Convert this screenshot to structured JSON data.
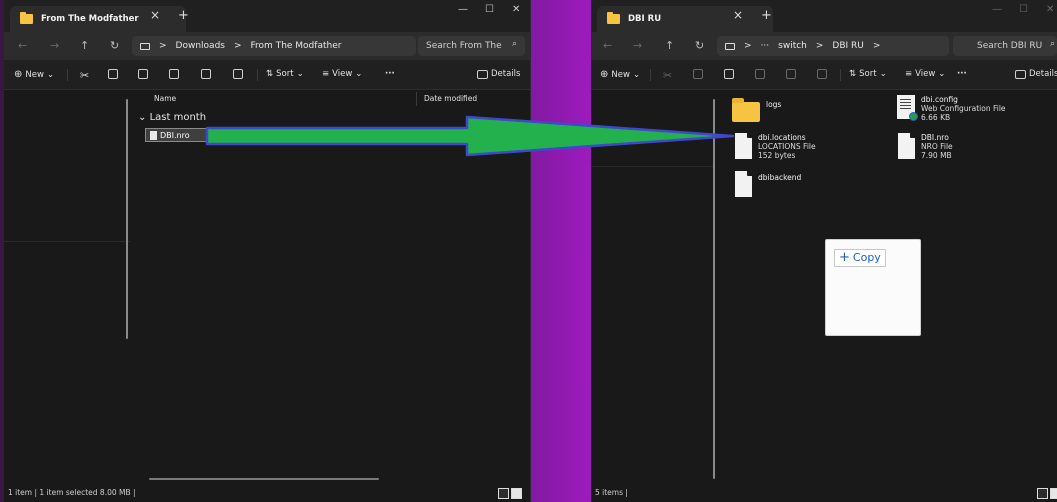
{
  "left_window": {
    "tab_title": "From The Modfather",
    "tab_close": "×",
    "tab_new": "+",
    "controls": {
      "minimize": "—",
      "maximize": "☐",
      "close": "✕"
    },
    "nav": {
      "back": "←",
      "forward": "→",
      "up": "↑",
      "refresh": "↻"
    },
    "breadcrumb": {
      "sep1": ">",
      "item1": "Downloads",
      "sep2": ">",
      "item2": "From The Modfather"
    },
    "search_placeholder": "Search From The",
    "search_icon": "⌕",
    "commands": {
      "new_label": "New",
      "sort_label": "Sort",
      "view_label": "View",
      "more_label": "···",
      "details_label": "Details",
      "chevron": "⌄"
    },
    "columns": {
      "name": "Name",
      "date_modified": "Date modified"
    },
    "group": {
      "chevron": "⌄",
      "label": "Last month"
    },
    "files": [
      {
        "name": "DBI.nro"
      }
    ],
    "status": "1 item  |  1 item selected  8.00 MB  |"
  },
  "right_window": {
    "tab_title": "DBI RU",
    "tab_close": "×",
    "tab_new": "+",
    "controls": {
      "minimize": "—",
      "maximize": "☐",
      "close": "✕"
    },
    "nav": {
      "back": "←",
      "forward": "→",
      "up": "↑",
      "refresh": "↻"
    },
    "breadcrumb": {
      "sep1": ">",
      "ellipsis": "···",
      "item1": "switch",
      "sep2": ">",
      "item2": "DBI RU",
      "sep3": ">"
    },
    "search_placeholder": "Search DBI RU",
    "search_icon": "⌕",
    "commands": {
      "new_label": "New",
      "sort_label": "Sort",
      "view_label": "View",
      "more_label": "···",
      "details_label": "Details",
      "chevron": "⌄"
    },
    "nav_chevron": "⌄",
    "items": [
      {
        "name": "logs",
        "type": "",
        "size": ""
      },
      {
        "name": "dbi.config",
        "type": "Web Configuration File",
        "size": "6.66 KB"
      },
      {
        "name": "dbi.locations",
        "type": "LOCATIONS File",
        "size": "152 bytes"
      },
      {
        "name": "DBI.nro",
        "type": "NRO File",
        "size": "7.90 MB"
      },
      {
        "name": "dbibackend",
        "type": "",
        "size": ""
      }
    ],
    "status": "5 items  |"
  },
  "drag_popup": {
    "label": "Copy",
    "plus": "+"
  },
  "colors": {
    "arrow_fill": "#22b14c",
    "arrow_stroke": "#3f48cc",
    "folder": "#f6c343",
    "window_bg": "#191919"
  }
}
